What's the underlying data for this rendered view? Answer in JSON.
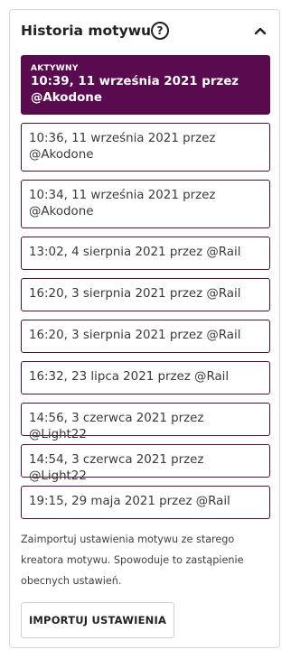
{
  "panel": {
    "title": "Historia motywu",
    "help_icon": "question-circle-icon",
    "help_glyph": "?",
    "collapse_icon": "chevron-up-icon"
  },
  "history": {
    "active_badge": "AKTYWNY",
    "entries": [
      {
        "label": "10:39, 11 września 2021 przez @Akodone",
        "active": true
      },
      {
        "label": "10:36, 11 września 2021 przez @Akodone",
        "active": false
      },
      {
        "label": "10:34, 11 września 2021 przez @Akodone",
        "active": false
      },
      {
        "label": "13:02, 4 sierpnia 2021 przez @Rail",
        "active": false
      },
      {
        "label": "16:20, 3 sierpnia 2021 przez @Rail",
        "active": false
      },
      {
        "label": "16:20, 3 sierpnia 2021 przez @Rail",
        "active": false
      },
      {
        "label": "16:32, 23 lipca 2021 przez @Rail",
        "active": false
      },
      {
        "label": "14:56, 3 czerwca 2021 przez @Light22",
        "active": false
      },
      {
        "label": "14:54, 3 czerwca 2021 przez @Light22",
        "active": false
      },
      {
        "label": "19:15, 29 maja 2021 przez @Rail",
        "active": false
      }
    ]
  },
  "import": {
    "note": "Zaimportuj ustawienia motywu ze starego kreatora motywu. Spowoduje to zastąpienie obecnych ustawień.",
    "button_label": "IMPORTUJ USTAWIENIA"
  },
  "colors": {
    "active_bg": "#5a0a4e",
    "entry_border": "#4a0e3e"
  }
}
